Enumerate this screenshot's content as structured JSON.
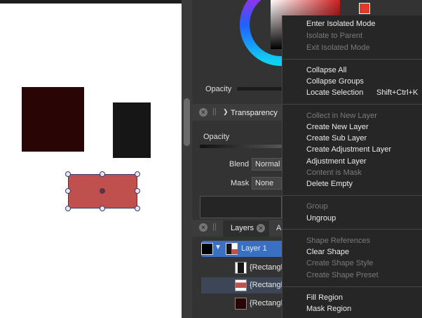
{
  "color_panel": {
    "opacity_label": "Opacity"
  },
  "transparency_panel": {
    "tab_label": "Transparency",
    "opacity_label": "Opacity",
    "blend_label": "Blend",
    "blend_value": "Normal",
    "mask_label": "Mask",
    "mask_value": "None"
  },
  "layers_panel": {
    "tab_label": "Layers",
    "next_tab_label": "A",
    "layers": [
      {
        "name": "Layer 1"
      },
      {
        "name": "{Rectangle"
      },
      {
        "name": "{Rectangle"
      },
      {
        "name": "{Rectangle"
      }
    ]
  },
  "context_menu": {
    "enter_isolated": "Enter Isolated Mode",
    "isolate_parent": "Isolate to Parent",
    "exit_isolated": "Exit Isolated Mode",
    "collapse_all": "Collapse All",
    "collapse_groups": "Collapse Groups",
    "locate_selection": "Locate Selection",
    "locate_selection_shortcut": "Shift+Ctrl+K",
    "collect_in_new_layer": "Collect in New Layer",
    "create_new_layer": "Create New Layer",
    "create_sub_layer": "Create Sub Layer",
    "create_adjustment_layer": "Create Adjustment Layer",
    "adjustment_layer": "Adjustment Layer",
    "content_is_mask": "Content is Mask",
    "delete_empty": "Delete Empty",
    "group": "Group",
    "ungroup": "Ungroup",
    "shape_references": "Shape References",
    "clear_shape": "Clear Shape",
    "create_shape_style": "Create Shape Style",
    "create_shape_preset": "Create Shape Preset",
    "fill_region": "Fill Region",
    "mask_region": "Mask Region"
  },
  "colors": {
    "shape_dark_red": "#2a0505",
    "shape_black": "#161616",
    "shape_selected_red": "#c0504d",
    "selection_highlight": "#3a6fc4"
  }
}
